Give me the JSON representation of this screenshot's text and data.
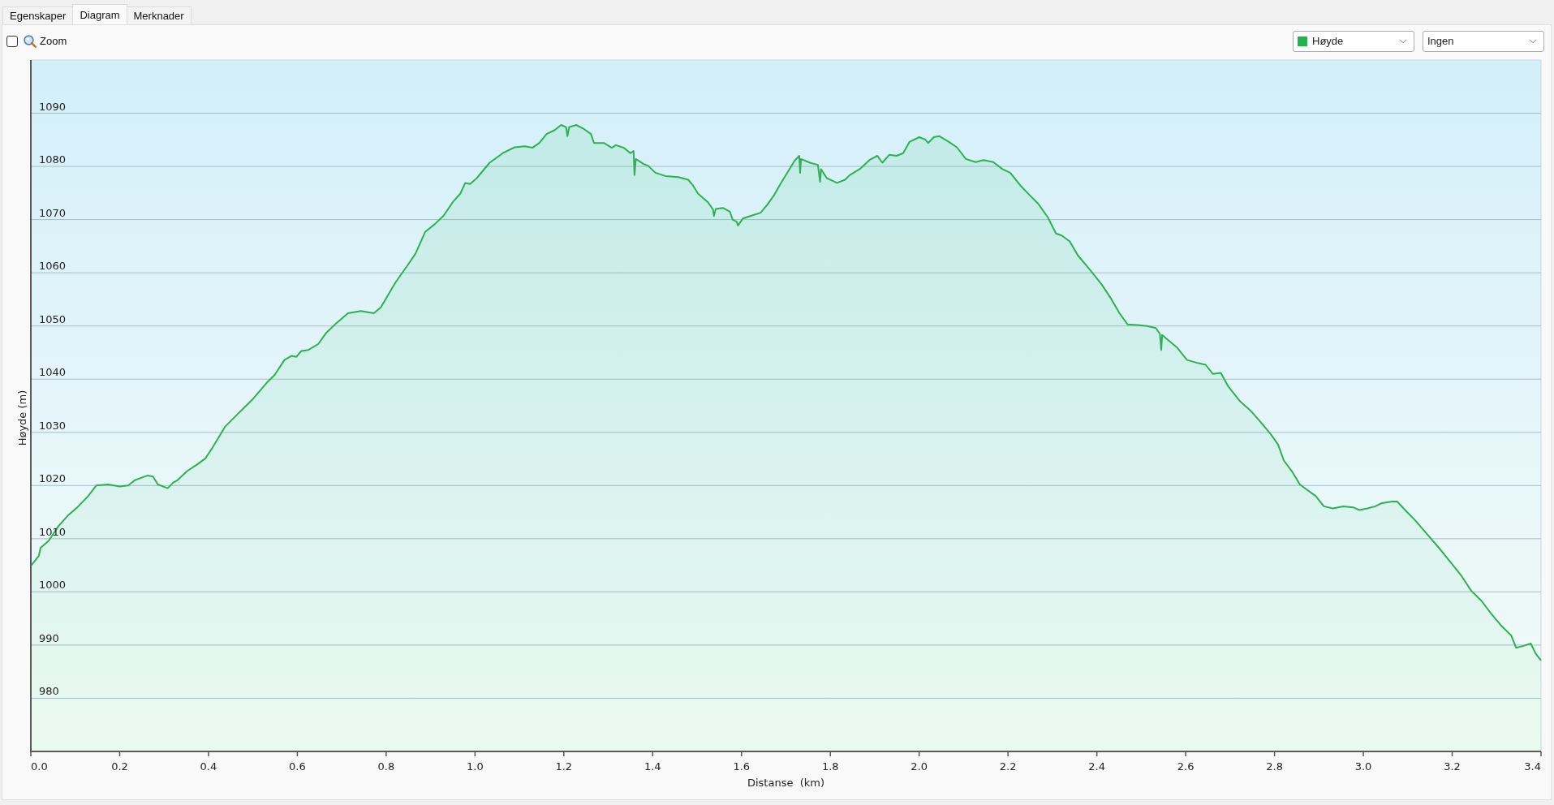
{
  "tabs": [
    {
      "label": "Egenskaper",
      "selected": false
    },
    {
      "label": "Diagram",
      "selected": true
    },
    {
      "label": "Merknader",
      "selected": false
    }
  ],
  "toolbar": {
    "zoom": {
      "label": "Zoom",
      "checked": false
    },
    "dropdowns": [
      {
        "value": "Høyde",
        "color": "#22b14c"
      },
      {
        "value": "Ingen"
      }
    ]
  },
  "chart": {
    "chart_data": {
      "type": "area",
      "grid": true,
      "xlabel": "Distanse  (km)",
      "ylabel": "Høyde (m)",
      "x": [
        0,
        0.018,
        0.022,
        0.04,
        0.0625,
        0.085,
        0.107,
        0.129,
        0.147,
        0.174,
        0.2,
        0.219,
        0.234,
        0.263,
        0.275,
        0.286,
        0.308,
        0.321,
        0.33,
        0.353,
        0.375,
        0.393,
        0.408,
        0.4375,
        0.464,
        0.498,
        0.531,
        0.549,
        0.571,
        0.587,
        0.598,
        0.609,
        0.625,
        0.647,
        0.665,
        0.6875,
        0.714,
        0.743,
        0.772,
        0.788,
        0.821,
        0.848,
        0.866,
        0.888,
        0.91,
        0.929,
        0.951,
        0.967,
        0.978,
        0.989,
        1.004,
        1.033,
        1.0625,
        1.089,
        1.112,
        1.129,
        1.145,
        1.161,
        1.179,
        1.194,
        1.205,
        1.208,
        1.212,
        1.228,
        1.246,
        1.261,
        1.268,
        1.29,
        1.308,
        1.317,
        1.335,
        1.35,
        1.357,
        1.359,
        1.362,
        1.379,
        1.39,
        1.406,
        1.429,
        1.458,
        1.48,
        1.491,
        1.502,
        1.513,
        1.525,
        1.536,
        1.538,
        1.542,
        1.558,
        1.574,
        1.58,
        1.589,
        1.592,
        1.603,
        1.621,
        1.643,
        1.658,
        1.674,
        1.6875,
        1.703,
        1.719,
        1.73,
        1.732,
        1.734,
        1.754,
        1.772,
        1.777,
        1.779,
        1.792,
        1.815,
        1.833,
        1.844,
        1.866,
        1.888,
        1.906,
        1.917,
        1.933,
        1.949,
        1.964,
        1.978,
        2,
        2.013,
        2.02,
        2.033,
        2.045,
        2.067,
        2.085,
        2.105,
        2.127,
        2.145,
        2.167,
        2.1875,
        2.205,
        2.228,
        2.25,
        2.268,
        2.29,
        2.308,
        2.321,
        2.339,
        2.357,
        2.384,
        2.411,
        2.433,
        2.451,
        2.469,
        2.491,
        2.513,
        2.533,
        2.542,
        2.545,
        2.547,
        2.5625,
        2.58,
        2.603,
        2.629,
        2.645,
        2.661,
        2.679,
        2.696,
        2.723,
        2.746,
        2.768,
        2.792,
        2.808,
        2.821,
        2.839,
        2.857,
        2.875,
        2.893,
        2.911,
        2.931,
        2.955,
        2.977,
        2.991,
        3.009,
        3.027,
        3.042,
        3.065,
        3.076,
        3.094,
        3.116,
        3.143,
        3.17,
        3.199,
        3.221,
        3.243,
        3.266,
        3.288,
        3.31,
        3.333,
        3.344,
        3.362,
        3.377,
        3.388,
        3.4
      ],
      "series": [
        {
          "color": "#2db24f",
          "values": [
            1004.9,
            1006.8,
            1008.3,
            1009.6,
            1012.4,
            1014.5,
            1016.1,
            1018,
            1020,
            1020.2,
            1019.8,
            1020,
            1021,
            1021.9,
            1021.7,
            1020.2,
            1019.5,
            1020.6,
            1021,
            1022.8,
            1024,
            1025.1,
            1027,
            1031.1,
            1033.3,
            1036.1,
            1039.3,
            1040.8,
            1043.6,
            1044.4,
            1044.2,
            1045.3,
            1045.5,
            1046.6,
            1048.7,
            1050.5,
            1052.4,
            1052.8,
            1052.4,
            1053.5,
            1058.2,
            1061.4,
            1063.6,
            1067.7,
            1069.2,
            1070.7,
            1073.4,
            1074.9,
            1076.9,
            1076.7,
            1077.8,
            1080.7,
            1082.5,
            1083.6,
            1083.8,
            1083.5,
            1084.4,
            1086.1,
            1086.8,
            1087.8,
            1087.4,
            1085.7,
            1087.4,
            1087.8,
            1087,
            1086.1,
            1084.4,
            1084.4,
            1083.5,
            1084,
            1083.5,
            1082.5,
            1082.9,
            1078.4,
            1081.4,
            1080.5,
            1080.1,
            1078.8,
            1078.2,
            1078,
            1077.5,
            1076.4,
            1074.9,
            1074.1,
            1073.2,
            1071.9,
            1070.7,
            1072,
            1072.2,
            1071.5,
            1070,
            1069.6,
            1068.9,
            1070.2,
            1070.7,
            1071.3,
            1072.8,
            1074.7,
            1076.7,
            1078.8,
            1081,
            1082,
            1078.8,
            1081.4,
            1080.7,
            1080.3,
            1077.1,
            1079.5,
            1077.8,
            1076.9,
            1077.5,
            1078.4,
            1079.5,
            1081.2,
            1082,
            1080.7,
            1082.2,
            1082,
            1082.5,
            1084.6,
            1085.5,
            1085.1,
            1084.4,
            1085.5,
            1085.7,
            1084.6,
            1083.6,
            1081.4,
            1080.8,
            1081.2,
            1080.8,
            1079.5,
            1078.8,
            1076.4,
            1074.5,
            1073,
            1070.4,
            1067.4,
            1067,
            1065.9,
            1063.3,
            1060.6,
            1057.8,
            1055,
            1052.4,
            1050.3,
            1050.2,
            1050,
            1049.6,
            1048.5,
            1045.5,
            1048.3,
            1047.2,
            1046,
            1043.6,
            1043,
            1042.7,
            1041,
            1041.2,
            1038.6,
            1035.8,
            1034.1,
            1032,
            1029.6,
            1027.7,
            1024.7,
            1022.7,
            1020.2,
            1019.1,
            1018,
            1016.1,
            1015.7,
            1016.1,
            1015.9,
            1015.4,
            1015.7,
            1016.1,
            1016.7,
            1017,
            1017,
            1015.4,
            1013.5,
            1010.9,
            1008.3,
            1005.3,
            1003,
            1000.2,
            998.3,
            995.9,
            993.7,
            991.8,
            989.5,
            989.9,
            990.3,
            988.4,
            987.1
          ]
        }
      ],
      "xlim": [
        0,
        3.4
      ],
      "ylim": [
        970,
        1100
      ],
      "xticks": [
        {
          "value": 0,
          "label": "0.0"
        },
        {
          "value": 0.2,
          "label": "0.2"
        },
        {
          "value": 0.4,
          "label": "0.4"
        },
        {
          "value": 0.6,
          "label": "0.6"
        },
        {
          "value": 0.8,
          "label": "0.8"
        },
        {
          "value": 1,
          "label": "1.0"
        },
        {
          "value": 1.2,
          "label": "1.2"
        },
        {
          "value": 1.4,
          "label": "1.4"
        },
        {
          "value": 1.6,
          "label": "1.6"
        },
        {
          "value": 1.8,
          "label": "1.8"
        },
        {
          "value": 2,
          "label": "2.0"
        },
        {
          "value": 2.2,
          "label": "2.2"
        },
        {
          "value": 2.4,
          "label": "2.4"
        },
        {
          "value": 2.6,
          "label": "2.6"
        },
        {
          "value": 2.8,
          "label": "2.8"
        },
        {
          "value": 3,
          "label": "3.0"
        },
        {
          "value": 3.2,
          "label": "3.2"
        },
        {
          "value": 3.4,
          "label": "3.4"
        }
      ],
      "yticks": [
        980,
        990,
        1000,
        1010,
        1020,
        1030,
        1040,
        1050,
        1060,
        1070,
        1080,
        1090
      ]
    }
  }
}
